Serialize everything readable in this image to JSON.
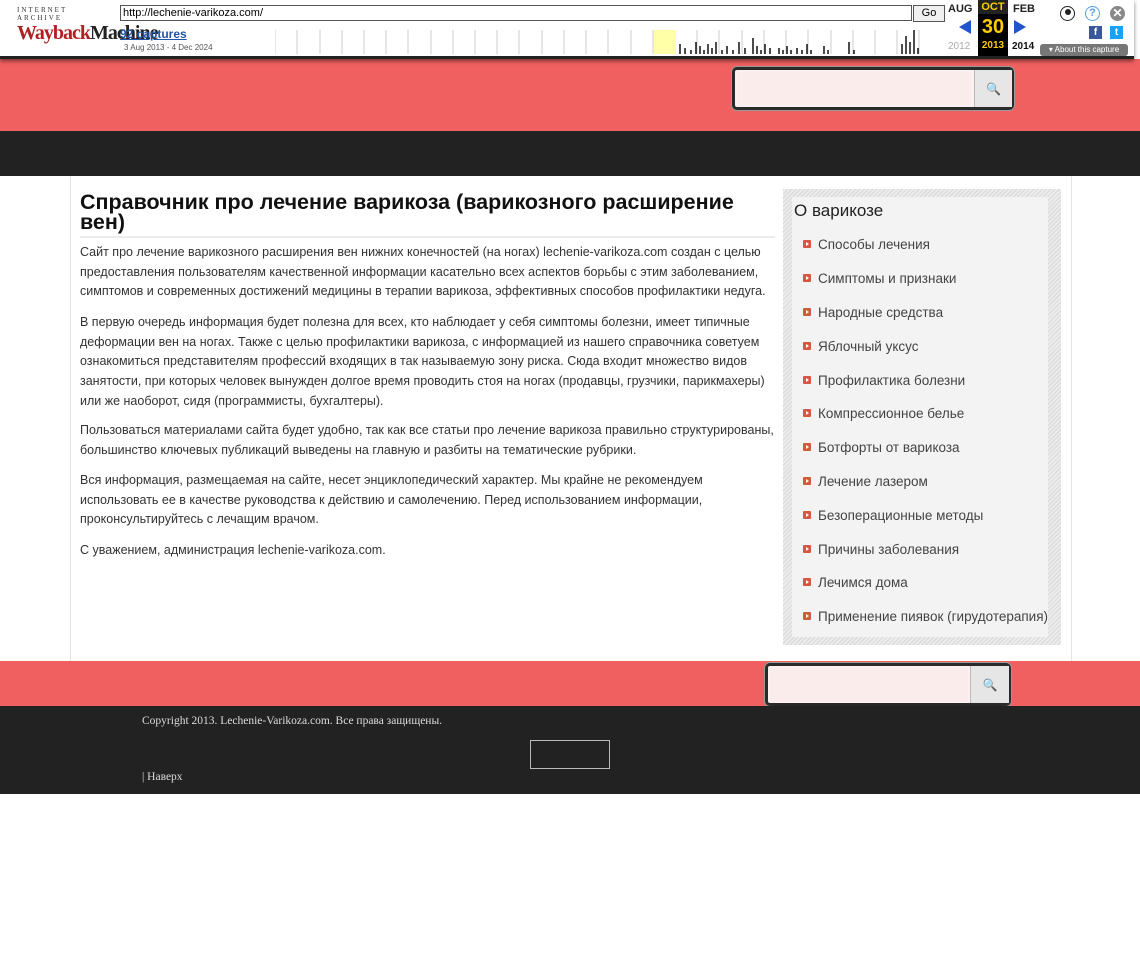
{
  "wayback": {
    "logo_top": "INTERNET ARCHIVE",
    "logo_wayback": "Wayback",
    "logo_machine": "Machine",
    "url": "http://lechenie-varikoza.com/",
    "go_label": "Go",
    "captures": "92 captures",
    "range": "3 Aug 2013 - 4 Dec 2024",
    "prev_month": "AUG",
    "current_month": "OCT",
    "current_day": "30",
    "current_year": "2013",
    "next_month": "FEB",
    "prev_year": "2012",
    "next_year": "2014",
    "about": "About this capture",
    "icons": [
      "user-icon",
      "help-icon",
      "close-icon",
      "facebook-icon",
      "twitter-icon",
      "search-icon"
    ]
  },
  "page": {
    "title": "Справочник про лечение варикоза (варикозного расширение вен)",
    "paragraphs": [
      "Сайт про лечение варикозного расширения вен нижних конечностей (на ногах) lechenie-varikoza.com создан с целью предоставления пользователям качественной информации касательно всех аспектов борьбы с этим заболеванием, симптомов и современных достижений медицины в терапии варикоза, эффективных способов профилактики недуга.",
      "В первую очередь информация будет полезна для всех, кто наблюдает у себя симптомы болезни, имеет типичные деформации вен на ногах. Также с целью профилактики варикоза, с информацией из нашего справочника советуем ознакомиться представителям профессий входящих в так называемую зону риска. Сюда входит множество видов занятости, при которых человек вынужден долгое время проводить стоя на ногах (продавцы, грузчики, парикмахеры) или же наоборот, сидя (программисты, бухгалтеры).",
      "Пользоваться материалами сайта будет удобно, так как все статьи про лечение варикоза правильно структурированы, большинство ключевых публикаций выведены на главную и разбиты на тематические рубрики.",
      "Вся информация, размещаемая на сайте, несет энциклопедический характер. Мы крайне не рекомендуем использовать ее в качестве руководства к действию и самолечению. Перед использованием информации, проконсультируйтесь с лечащим врачом.",
      "С уважением, администрация lechenie-varikoza.com."
    ]
  },
  "sidebar": {
    "title": "О варикозе",
    "items": [
      "Способы лечения",
      "Симптомы и признаки",
      "Народные средства",
      "Яблочный уксус",
      "Профилактика болезни",
      "Компрессионное белье",
      "Ботфорты от варикоза",
      "Лечение лазером",
      "Безоперационные методы",
      "Причины заболевания",
      "Лечимся дома",
      "Применение пиявок (гирудотерапия)"
    ]
  },
  "footer": {
    "copyright": "Copyright 2013. Lechenie-Varikoza.com. Все права защищены.",
    "back_to_top": "| Наверх"
  },
  "colors": {
    "header_band": "#f06060",
    "nav_bar": "#222222",
    "bullet": "#d8563a",
    "wayback_link": "#2255aa",
    "wayback_highlight": "#fc0"
  }
}
